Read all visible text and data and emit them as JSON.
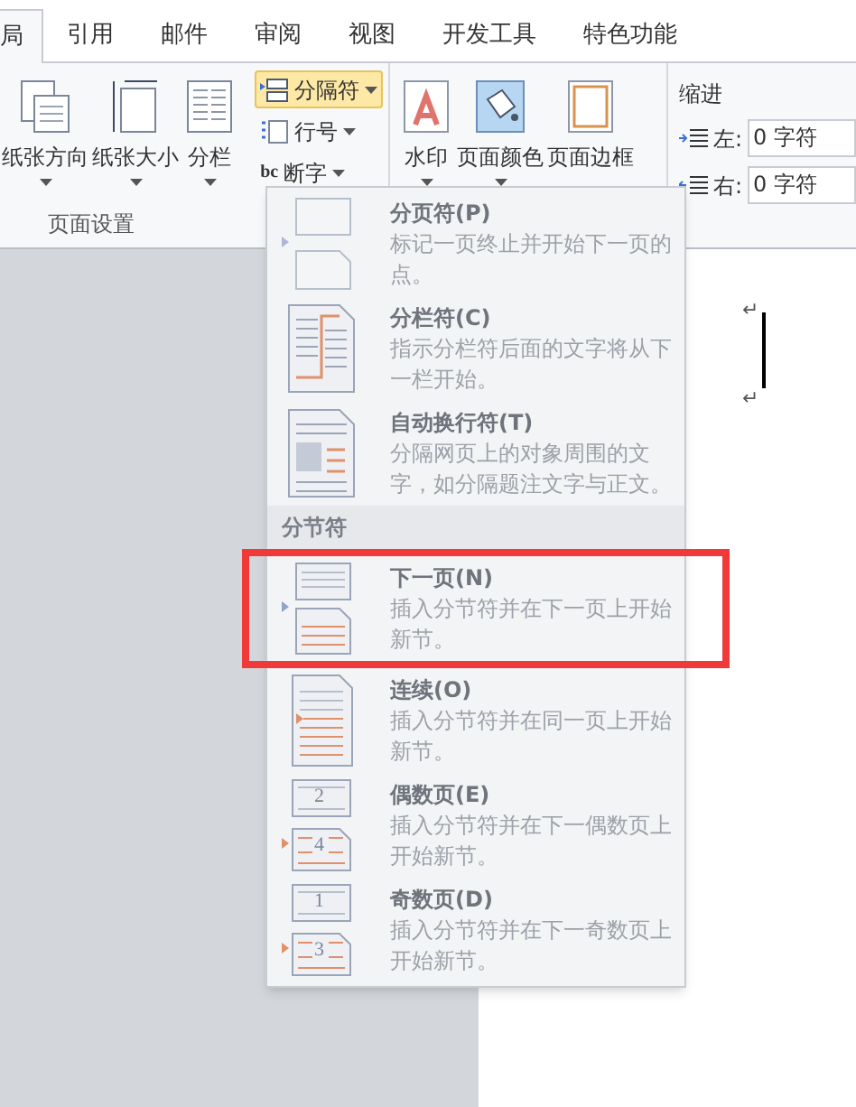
{
  "tabs": [
    {
      "label": "局",
      "selected": true
    },
    {
      "label": "引用",
      "selected": false
    },
    {
      "label": "邮件",
      "selected": false
    },
    {
      "label": "审阅",
      "selected": false
    },
    {
      "label": "视图",
      "selected": false
    },
    {
      "label": "开发工具",
      "selected": false
    },
    {
      "label": "特色功能",
      "selected": false
    }
  ],
  "page_setup": {
    "big_buttons": [
      {
        "kind": "orientation",
        "label": "纸张方向"
      },
      {
        "kind": "size",
        "label": "纸张大小"
      },
      {
        "kind": "columns",
        "label": "分栏"
      }
    ],
    "small_buttons": [
      {
        "kind": "breaks",
        "label": "分隔符",
        "selected": true
      },
      {
        "kind": "line_numbers",
        "label": "行号",
        "selected": false
      },
      {
        "kind": "hyphenation",
        "label": "断字",
        "selected": false
      }
    ],
    "hyphen_icon_text": "bc",
    "group_label": "页面设置"
  },
  "page_background": {
    "buttons": [
      {
        "kind": "watermark",
        "label": "水印",
        "dropdown": true
      },
      {
        "kind": "page_color",
        "label": "页面颜色",
        "dropdown": true
      },
      {
        "kind": "page_border",
        "label": "页面边框",
        "dropdown": false
      }
    ]
  },
  "indent": {
    "title": "缩进",
    "fields": [
      {
        "kind": "left",
        "label": "左:",
        "value": "0 字符"
      },
      {
        "kind": "right",
        "label": "右:",
        "value": "0 字符"
      }
    ]
  },
  "document": {
    "marks": [
      "↵",
      "↵"
    ]
  },
  "menu": {
    "items": [
      {
        "kind": "page_break",
        "title": "分页符(P)",
        "description": "标记一页终止并开始下一页的点。",
        "highlighted": false
      },
      {
        "kind": "column_break",
        "title": "分栏符(C)",
        "description": "指示分栏符后面的文字将从下一栏开始。",
        "highlighted": false
      },
      {
        "kind": "text_wrap",
        "title": "自动换行符(T)",
        "description": "分隔网页上的对象周围的文字，如分隔题注文字与正文。",
        "highlighted": false
      }
    ],
    "section": {
      "title": "分节符",
      "items": [
        {
          "kind": "next_page",
          "title": "下一页(N)",
          "description": "插入分节符并在下一页上开始新节。",
          "highlighted": true
        },
        {
          "kind": "continuous",
          "title": "连续(O)",
          "description": "插入分节符并在同一页上开始新节。",
          "highlighted": false
        },
        {
          "kind": "two_pages",
          "icon_numbers": [
            "2",
            "4"
          ],
          "title": "偶数页(E)",
          "description": "插入分节符并在下一偶数页上开始新节。",
          "highlighted": false
        },
        {
          "kind": "two_pages",
          "icon_numbers": [
            "1",
            "3"
          ],
          "title": "奇数页(D)",
          "description": "插入分节符并在下一奇数页上开始新节。",
          "highlighted": false
        }
      ]
    }
  }
}
